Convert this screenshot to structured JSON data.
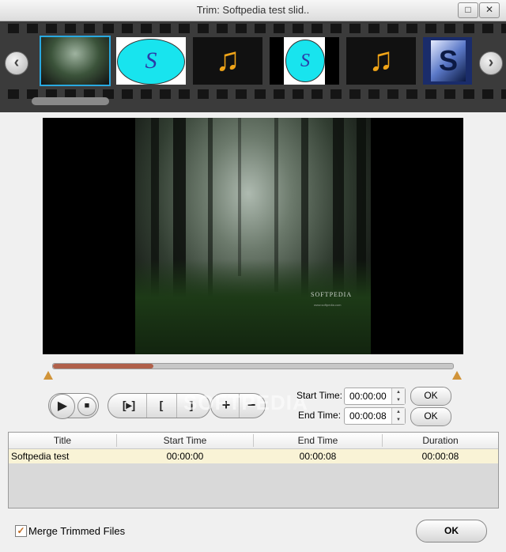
{
  "window": {
    "title": "Trim: Softpedia test slid..",
    "minimize_glyph": "□",
    "close_glyph": "✕"
  },
  "filmstrip": {
    "prev_glyph": "‹",
    "next_glyph": "›",
    "thumbnails": [
      {
        "type": "forest-image",
        "selected": true
      },
      {
        "type": "softpedia-logo"
      },
      {
        "type": "music-note"
      },
      {
        "type": "softpedia-logo"
      },
      {
        "type": "music-note"
      },
      {
        "type": "softpedia-s-logo"
      }
    ],
    "logo_letter": "S",
    "music_glyph": "♫"
  },
  "preview": {
    "watermark": "SOFTPEDIA",
    "watermark_sub": "www.softpedia.com"
  },
  "seekbar": {
    "progress": 0.25
  },
  "controls": {
    "play_glyph": "▶",
    "stop_glyph": "■",
    "mark_play_glyph": "[▸]",
    "mark_in_glyph": "[",
    "mark_out_glyph": "]",
    "add_glyph": "+",
    "remove_glyph": "−",
    "watermark": "SOFTPEDIA"
  },
  "times": {
    "start_label": "Start Time:",
    "start_value": "00:00:00",
    "end_label": "End Time:",
    "end_value": "00:00:08",
    "ok_label": "OK"
  },
  "table": {
    "columns": [
      "Title",
      "Start Time",
      "End Time",
      "Duration"
    ],
    "rows": [
      {
        "title": "Softpedia test",
        "start": "00:00:00",
        "end": "00:00:08",
        "duration": "00:00:08"
      }
    ]
  },
  "footer": {
    "merge_label": "Merge Trimmed Files",
    "merge_checked": true,
    "check_glyph": "✓",
    "ok_label": "OK"
  },
  "colors": {
    "accent": "#d19439",
    "seek_fill": "#b0604a",
    "selected_row": "#f9f3d6",
    "thumb_selected_border": "#29a9e0"
  }
}
